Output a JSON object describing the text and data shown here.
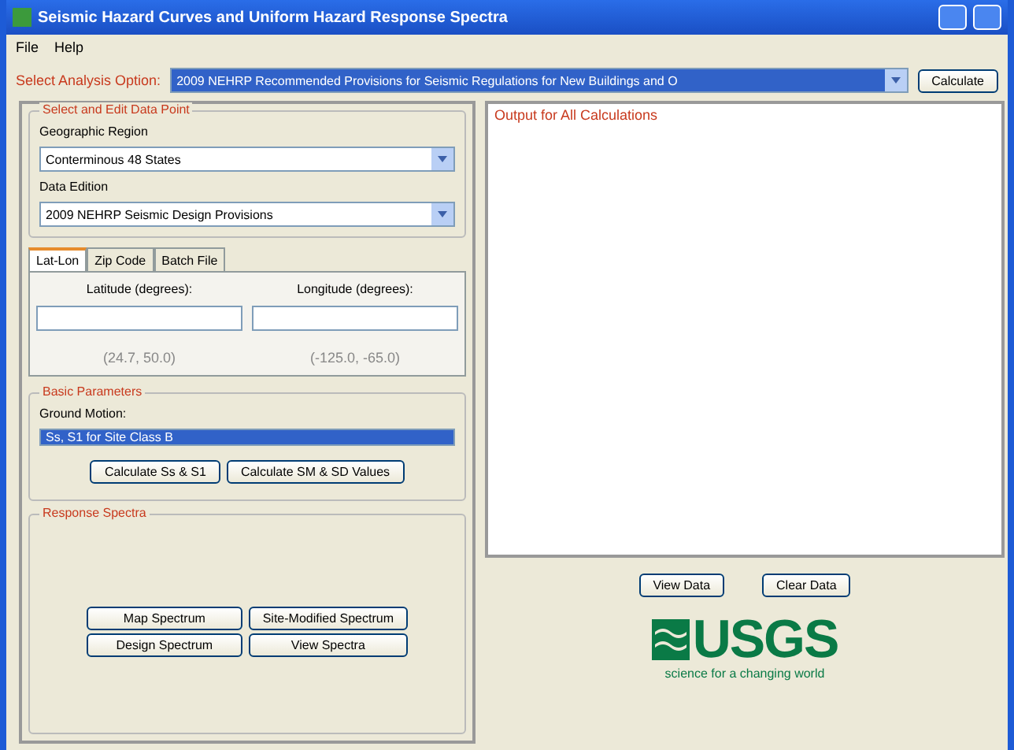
{
  "window": {
    "title": "Seismic Hazard Curves and Uniform Hazard Response Spectra"
  },
  "menu": [
    "File",
    "Help"
  ],
  "analysis": {
    "label": "Select Analysis Option:",
    "value": "2009 NEHRP Recommended Provisions for Seismic Regulations for New Buildings and O",
    "button": "Calculate"
  },
  "region_panel": {
    "title": "Select and Edit Data Point",
    "region": {
      "label": "Geographic Region",
      "value": "Conterminous 48 States"
    },
    "edition": {
      "label": "Data Edition",
      "value": "2009 NEHRP Seismic Design Provisions"
    }
  },
  "tabs": [
    {
      "label": "Lat-Lon",
      "selected": true
    },
    {
      "label": "Zip Code",
      "selected": false
    },
    {
      "label": "Batch File",
      "selected": false
    }
  ],
  "coords": [
    {
      "label": "Latitude (degrees):",
      "range": "(24.7, 50.0)"
    },
    {
      "label": "Longitude (degrees):",
      "range": "(-125.0, -65.0)"
    }
  ],
  "basic": {
    "title": "Basic Parameters",
    "group": "Ground Motion:",
    "value": "Ss, S1 for Site Class B",
    "buttons": [
      "Calculate Ss & S1",
      "Calculate SM & SD Values"
    ]
  },
  "spectra": {
    "title": "Response Spectra",
    "buttons": [
      "Map Spectrum",
      "Site-Modified Spectrum",
      "Design Spectrum",
      "View Spectra"
    ]
  },
  "output": {
    "title": "Output for All Calculations",
    "buttons": [
      "View Data",
      "Clear Data"
    ]
  },
  "logo": {
    "name": "USGS",
    "tagline": "science for a changing world"
  }
}
